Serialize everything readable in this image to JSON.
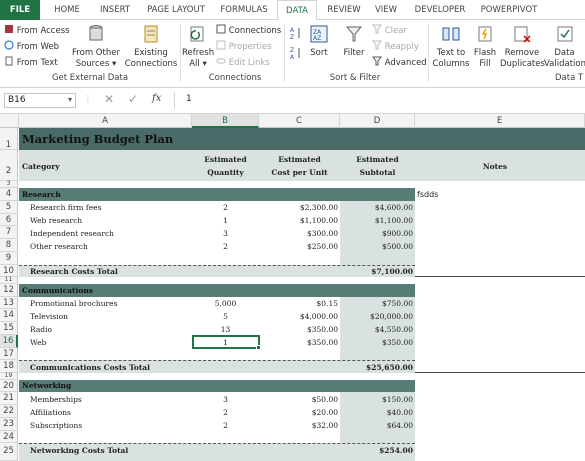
{
  "tabs": [
    "FILE",
    "HOME",
    "INSERT",
    "PAGE LAYOUT",
    "FORMULAS",
    "DATA",
    "REVIEW",
    "VIEW",
    "DEVELOPER",
    "POWERPIVOT"
  ],
  "active_tab": "DATA",
  "ribbon": {
    "get_external": {
      "from_access": "From Access",
      "from_web": "From Web",
      "from_text": "From Text",
      "from_other_1": "From Other",
      "from_other_2": "Sources",
      "existing_1": "Existing",
      "existing_2": "Connections",
      "label": "Get External Data"
    },
    "connections": {
      "refresh_1": "Refresh",
      "refresh_2": "All",
      "connections": "Connections",
      "properties": "Properties",
      "edit_links": "Edit Links",
      "label": "Connections"
    },
    "sort_filter": {
      "sort": "Sort",
      "filter": "Filter",
      "clear": "Clear",
      "reapply": "Reapply",
      "advanced": "Advanced",
      "label": "Sort & Filter"
    },
    "data_tools": {
      "text_to_1": "Text to",
      "text_to_2": "Columns",
      "flash_1": "Flash",
      "flash_2": "Fill",
      "remove_1": "Remove",
      "remove_2": "Duplicates",
      "validation_1": "Data",
      "validation_2": "Validation",
      "label": "Data T"
    }
  },
  "formula_bar": {
    "name_box": "B16",
    "fx": "fx",
    "value": "1"
  },
  "columns": [
    "A",
    "B",
    "C",
    "D",
    "E"
  ],
  "sheet": {
    "title": "Marketing Budget Plan",
    "headers": {
      "category": "Category",
      "qty_1": "Estimated",
      "qty_2": "Quantity",
      "cost_1": "Estimated",
      "cost_2": "Cost per Unit",
      "sub_1": "Estimated",
      "sub_2": "Subtotal",
      "notes": "Notes"
    },
    "research": {
      "heading": "Research",
      "note": "fsdds",
      "rows": [
        {
          "item": "Research firm fees",
          "qty": "2",
          "cost": "$2,300.00",
          "sub": "$4,600.00"
        },
        {
          "item": "Web research",
          "qty": "1",
          "cost": "$1,100.00",
          "sub": "$1,100.00"
        },
        {
          "item": "Independent research",
          "qty": "3",
          "cost": "$300.00",
          "sub": "$900.00"
        },
        {
          "item": "Other research",
          "qty": "2",
          "cost": "$250.00",
          "sub": "$500.00"
        }
      ],
      "total_label": "Research Costs Total",
      "total": "$7,100.00"
    },
    "communications": {
      "heading": "Communications",
      "rows": [
        {
          "item": "Promotional brochures",
          "qty": "5,000",
          "cost": "$0.15",
          "sub": "$750.00"
        },
        {
          "item": "Television",
          "qty": "5",
          "cost": "$4,000.00",
          "sub": "$20,000.00"
        },
        {
          "item": "Radio",
          "qty": "13",
          "cost": "$350.00",
          "sub": "$4,550.00"
        },
        {
          "item": "Web",
          "qty": "1",
          "cost": "$350.00",
          "sub": "$350.00"
        }
      ],
      "total_label": "Communications Costs Total",
      "total": "$25,650.00"
    },
    "networking": {
      "heading": "Networking",
      "rows": [
        {
          "item": "Memberships",
          "qty": "3",
          "cost": "$50.00",
          "sub": "$150.00"
        },
        {
          "item": "Affiliations",
          "qty": "2",
          "cost": "$20.00",
          "sub": "$40.00"
        },
        {
          "item": "Subscriptions",
          "qty": "2",
          "cost": "$32.00",
          "sub": "$64.00"
        }
      ],
      "total_label": "Networking Costs Total",
      "total": "$254.00"
    }
  },
  "row_numbers": [
    "1",
    "2",
    "3",
    "4",
    "5",
    "6",
    "7",
    "8",
    "9",
    "10",
    "11",
    "12",
    "13",
    "14",
    "15",
    "16",
    "17",
    "18",
    "19",
    "20",
    "21",
    "22",
    "23",
    "24",
    "25"
  ],
  "colors": {
    "accent": "#217346",
    "band": "#587c76",
    "header_fill": "#d9e2e1",
    "title_band": "#4a6a67"
  }
}
